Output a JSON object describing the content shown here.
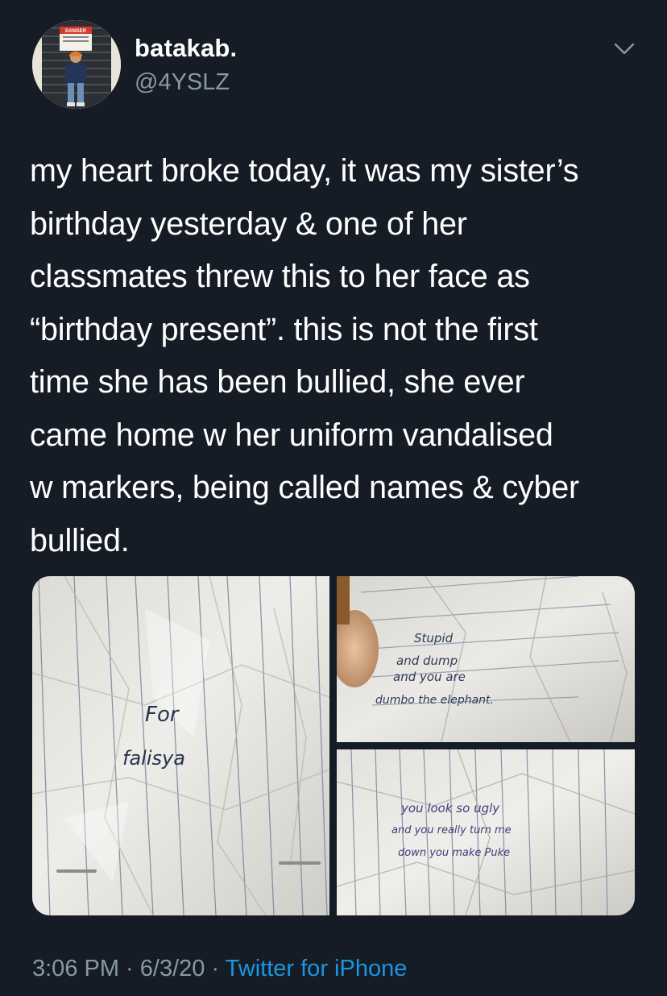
{
  "user": {
    "display_name": "batakab.",
    "handle": "@4YSLZ",
    "avatar_sign_text": "DANGER"
  },
  "tweet": {
    "text": "my heart broke today, it was my sister’s\nbirthday yesterday & one of her\nclassmates threw this to her face as\n“birthday present”. this is not the first\ntime she has been bullied, she ever\ncame home w her uniform vandalised\nw markers, being called names & cyber\nbullied."
  },
  "media": {
    "photo_1": {
      "line_1": "For",
      "line_2": "falisya"
    },
    "photo_2": {
      "line_1": "Stupid",
      "line_2": "and dump",
      "line_3": "and you are",
      "line_4": "dumbo the elephant."
    },
    "photo_3": {
      "line_1": "you look so ugly",
      "line_2": "and you really turn me",
      "line_3": "down you make Puke"
    }
  },
  "footer": {
    "time": "3:06 PM",
    "separator_1": " · ",
    "date": "6/3/20",
    "separator_2": " · ",
    "source": "Twitter for iPhone"
  },
  "icons": {
    "menu": "chevron-down-icon"
  },
  "colors": {
    "background": "#151c26",
    "text_primary": "#ffffff",
    "text_secondary": "#8899a6",
    "link": "#1b95e0"
  }
}
